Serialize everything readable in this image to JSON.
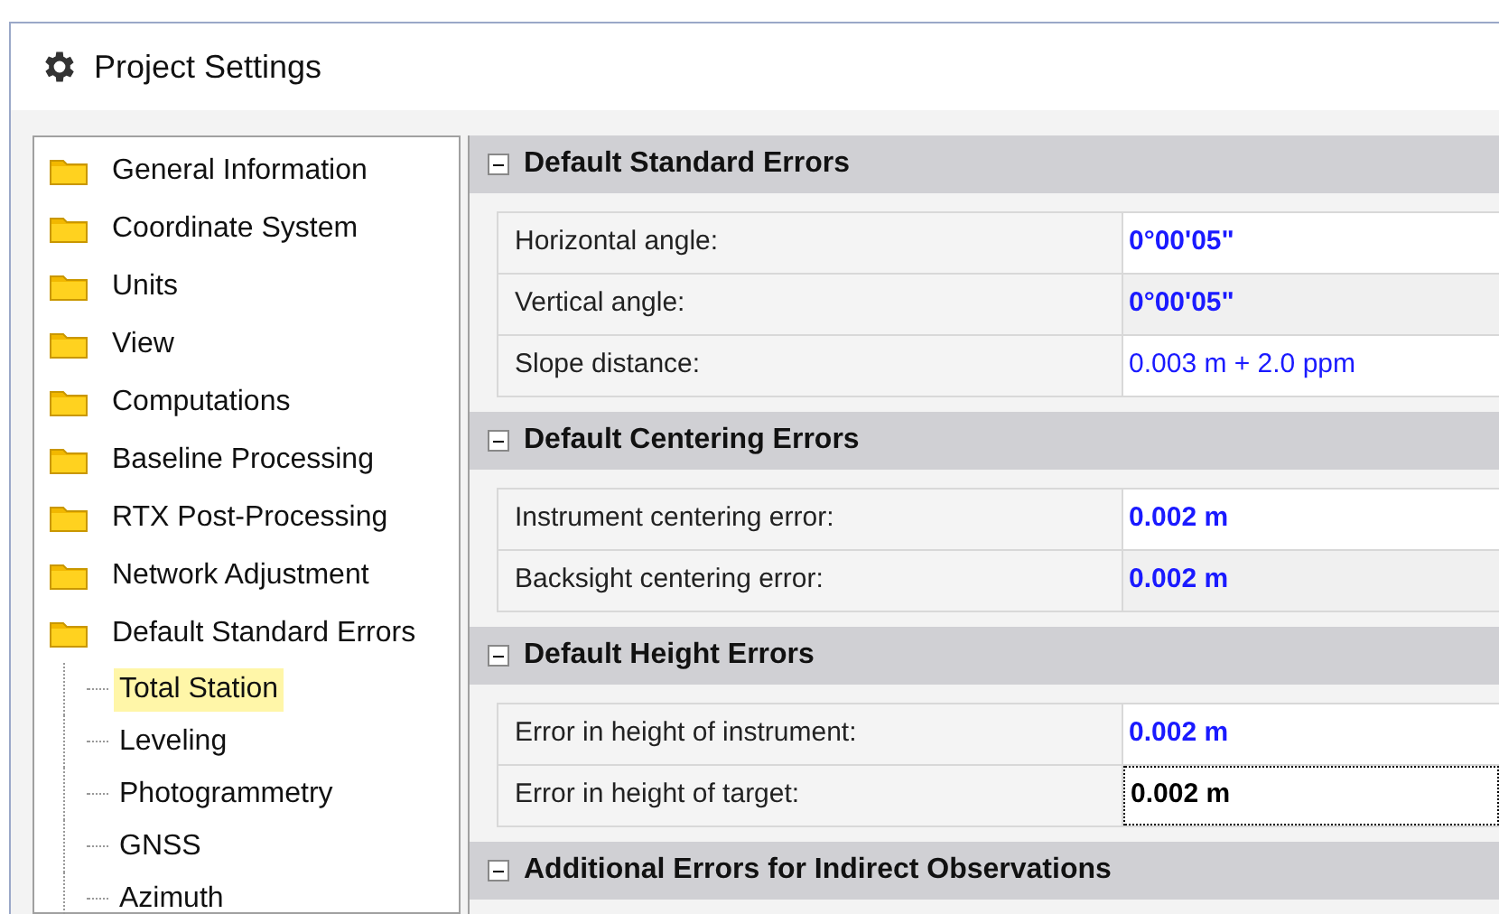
{
  "window": {
    "title": "Project Settings"
  },
  "sidebar": {
    "items": [
      {
        "label": "General Information"
      },
      {
        "label": "Coordinate System"
      },
      {
        "label": "Units"
      },
      {
        "label": "View"
      },
      {
        "label": "Computations"
      },
      {
        "label": "Baseline Processing"
      },
      {
        "label": "RTX Post-Processing"
      },
      {
        "label": "Network Adjustment"
      },
      {
        "label": "Default Standard Errors",
        "children": [
          {
            "label": "Total Station",
            "selected": true
          },
          {
            "label": "Leveling",
            "selected": false
          },
          {
            "label": "Photogrammetry",
            "selected": false
          },
          {
            "label": "GNSS",
            "selected": false
          },
          {
            "label": "Azimuth",
            "selected": false
          }
        ]
      }
    ]
  },
  "sections": [
    {
      "title": "Default Standard Errors",
      "expanded": true,
      "rows": [
        {
          "label": "Horizontal angle:",
          "value": "0°00'05\"",
          "bold": true,
          "focused": false
        },
        {
          "label": "Vertical angle:",
          "value": "0°00'05\"",
          "bold": true,
          "focused": false
        },
        {
          "label": "Slope distance:",
          "value": "0.003 m + 2.0 ppm",
          "bold": false,
          "focused": false
        }
      ]
    },
    {
      "title": "Default Centering Errors",
      "expanded": true,
      "rows": [
        {
          "label": "Instrument centering error:",
          "value": "0.002 m",
          "bold": true,
          "focused": false
        },
        {
          "label": "Backsight centering error:",
          "value": "0.002 m",
          "bold": true,
          "focused": false
        }
      ]
    },
    {
      "title": "Default Height Errors",
      "expanded": true,
      "rows": [
        {
          "label": "Error in height of instrument:",
          "value": "0.002 m",
          "bold": true,
          "focused": false
        },
        {
          "label": "Error in height of target:",
          "value": "0.002 m",
          "bold": true,
          "focused": true
        }
      ]
    },
    {
      "title": "Additional Errors for Indirect Observations",
      "expanded": true
    }
  ]
}
